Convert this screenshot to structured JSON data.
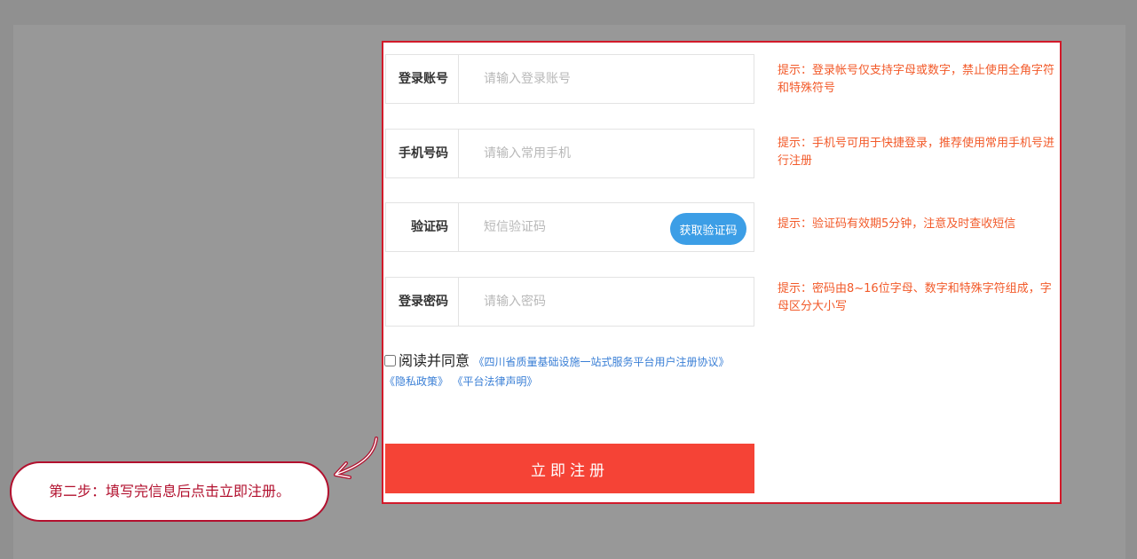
{
  "form": {
    "fields": [
      {
        "label": "登录账号",
        "placeholder": "请输入登录账号",
        "hint": "提示：登录帐号仅支持字母或数字，禁止使用全角字符和特殊符号"
      },
      {
        "label": "手机号码",
        "placeholder": "请输入常用手机",
        "hint": "提示：手机号可用于快捷登录，推荐使用常用手机号进行注册"
      },
      {
        "label": "验证码",
        "placeholder": "短信验证码",
        "button": "获取验证码",
        "hint": "提示：验证码有效期5分钟，注意及时查收短信"
      },
      {
        "label": "登录密码",
        "placeholder": "请输入密码",
        "hint": "提示：密码由8~16位字母、数字和特殊字符组成，字母区分大小写"
      }
    ],
    "agreement": {
      "prefix": "阅读并同意",
      "links": [
        "《四川省质量基础设施一站式服务平台用户注册协议》",
        "《隐私政策》",
        "《平台法律声明》"
      ]
    },
    "submit_label": "立即注册"
  },
  "callout": {
    "text": "第二步：填写完信息后点击立即注册。"
  },
  "colors": {
    "panel_border": "#d21a2a",
    "hint_text": "#f25a2a",
    "sms_button": "#3c9ee6",
    "submit_button": "#f54336",
    "link": "#3a7fd6",
    "callout": "#b2102e"
  }
}
